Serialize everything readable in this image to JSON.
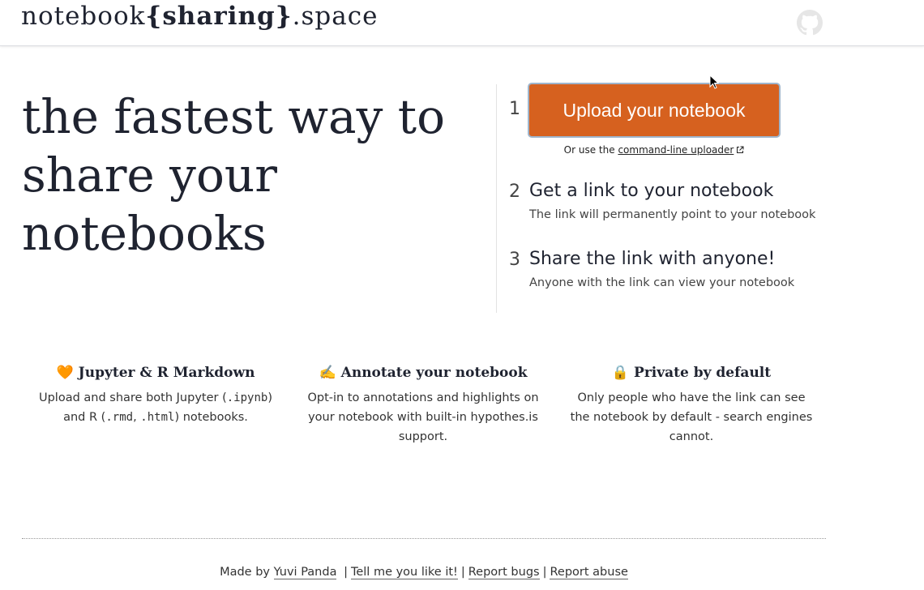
{
  "header": {
    "logo_prefix": "notebook",
    "logo_open": "{",
    "logo_bold": "sharing",
    "logo_close": "}",
    "logo_suffix": ".space",
    "github_icon": "github-icon"
  },
  "hero": {
    "line1": "the fastest way to",
    "line2": "share your",
    "line3": "notebooks"
  },
  "steps": [
    {
      "number": "1",
      "button_label": "Upload your notebook",
      "note_prefix": "Or use the",
      "note_link": "command-line uploader"
    },
    {
      "number": "2",
      "title": "Get a link to your notebook",
      "description": "The link will permanently point to your notebook"
    },
    {
      "number": "3",
      "title": "Share the link with anyone!",
      "description": "Anyone with the link can view your notebook"
    }
  ],
  "features": [
    {
      "icon": "🧡",
      "title": "Jupyter & R Markdown",
      "text_a": "Upload and share both Jupyter (",
      "code_a": ".ipynb",
      "text_b": ")",
      "text_c": "and R (",
      "code_b": ".rmd",
      "text_d": ", ",
      "code_c": ".html",
      "text_e": ") notebooks."
    },
    {
      "icon": "✍️",
      "title": "Annotate your notebook",
      "line1": "Opt-in to annotations and highlights on",
      "line2": "your notebook with built-in hypothes.is",
      "line3": "support."
    },
    {
      "icon": "🔒",
      "title": "Private by default",
      "line1": "Only people who have the link can see",
      "line2": "the notebook by default - search engines",
      "line3": "cannot."
    }
  ],
  "footer": {
    "made_by_prefix": "Made by",
    "author": "Yuvi Panda",
    "separator": "|",
    "like_link": "Tell me you like it!",
    "bugs_link": "Report bugs",
    "abuse_link": "Report abuse"
  },
  "colors": {
    "accent": "#d6611f",
    "text": "#1f2330"
  }
}
